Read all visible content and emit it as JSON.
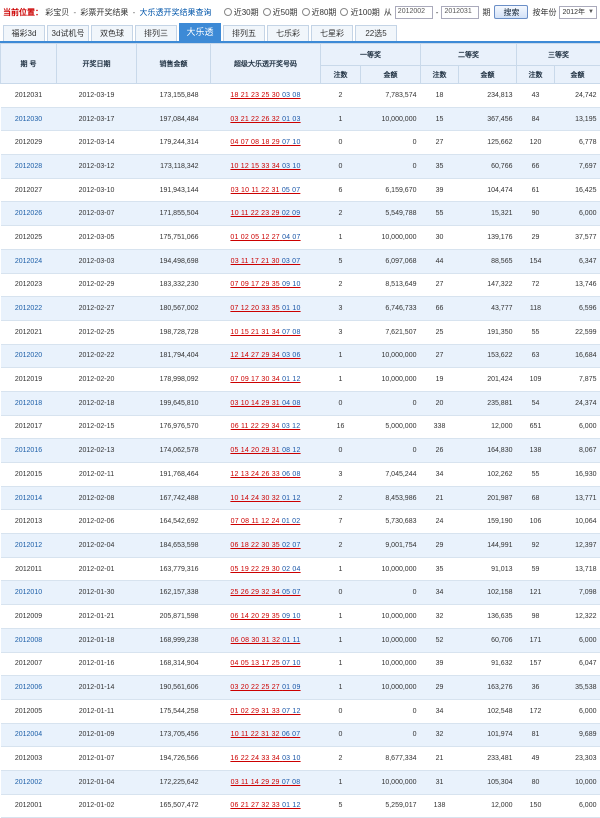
{
  "breadcrumb": {
    "label": "当前位置：",
    "items": [
      "彩宝贝",
      "彩票开奖结果",
      "大乐透开奖结果查询"
    ],
    "sep": "-"
  },
  "filters": {
    "radios": [
      "近30期",
      "近50期",
      "近80期",
      "近100期"
    ],
    "from_label": "从",
    "from_value": "2012002",
    "to_value": "2012031",
    "period_label": "期",
    "search_label": "搜索",
    "year_label": "按年份",
    "year_value": "2012年"
  },
  "tabs": [
    "福彩3d",
    "3d试机号",
    "双色球",
    "排列三",
    "大乐透",
    "排列五",
    "七乐彩",
    "七星彩",
    "22选5"
  ],
  "active_tab": 4,
  "table": {
    "headers": {
      "issue": "期 号",
      "date": "开奖日期",
      "sales": "销售金额",
      "numbers": "超级大乐透开奖号码",
      "first": "一等奖",
      "second": "二等奖",
      "third": "三等奖",
      "count": "注数",
      "amount": "金额"
    },
    "rows": [
      {
        "issue": "2012031",
        "date": "2012-03-19",
        "sales": "173,155,848",
        "front": "18 21 23 25 30",
        "back": "03 08",
        "c1": "2",
        "a1": "7,783,574",
        "c2": "18",
        "a2": "234,813",
        "c3": "43",
        "a3": "24,742"
      },
      {
        "issue": "2012030",
        "date": "2012-03-17",
        "sales": "197,084,484",
        "front": "03 21 22 26 32",
        "back": "01 03",
        "c1": "1",
        "a1": "10,000,000",
        "c2": "15",
        "a2": "367,456",
        "c3": "84",
        "a3": "13,195"
      },
      {
        "issue": "2012029",
        "date": "2012-03-14",
        "sales": "179,244,314",
        "front": "04 07 08 18 29",
        "back": "07 10",
        "c1": "0",
        "a1": "0",
        "c2": "27",
        "a2": "125,662",
        "c3": "120",
        "a3": "6,778"
      },
      {
        "issue": "2012028",
        "date": "2012-03-12",
        "sales": "173,118,342",
        "front": "10 12 15 33 34",
        "back": "03 10",
        "c1": "0",
        "a1": "0",
        "c2": "35",
        "a2": "60,766",
        "c3": "66",
        "a3": "7,697"
      },
      {
        "issue": "2012027",
        "date": "2012-03-10",
        "sales": "191,943,144",
        "front": "03 10 11 22 31",
        "back": "05 07",
        "c1": "6",
        "a1": "6,159,670",
        "c2": "39",
        "a2": "104,474",
        "c3": "61",
        "a3": "16,425"
      },
      {
        "issue": "2012026",
        "date": "2012-03-07",
        "sales": "171,855,504",
        "front": "10 11 22 23 29",
        "back": "02 09",
        "c1": "2",
        "a1": "5,549,788",
        "c2": "55",
        "a2": "15,321",
        "c3": "90",
        "a3": "6,000"
      },
      {
        "issue": "2012025",
        "date": "2012-03-05",
        "sales": "175,751,066",
        "front": "01 02 05 12 27",
        "back": "04 07",
        "c1": "1",
        "a1": "10,000,000",
        "c2": "30",
        "a2": "139,176",
        "c3": "29",
        "a3": "37,577"
      },
      {
        "issue": "2012024",
        "date": "2012-03-03",
        "sales": "194,498,698",
        "front": "03 11 17 21 30",
        "back": "03 07",
        "c1": "5",
        "a1": "6,097,068",
        "c2": "44",
        "a2": "88,565",
        "c3": "154",
        "a3": "6,347"
      },
      {
        "issue": "2012023",
        "date": "2012-02-29",
        "sales": "183,332,230",
        "front": "07 09 17 29 35",
        "back": "09 10",
        "c1": "2",
        "a1": "8,513,649",
        "c2": "27",
        "a2": "147,322",
        "c3": "72",
        "a3": "13,746"
      },
      {
        "issue": "2012022",
        "date": "2012-02-27",
        "sales": "180,567,002",
        "front": "07 12 20 33 35",
        "back": "01 10",
        "c1": "3",
        "a1": "6,746,733",
        "c2": "66",
        "a2": "43,777",
        "c3": "118",
        "a3": "6,596"
      },
      {
        "issue": "2012021",
        "date": "2012-02-25",
        "sales": "198,728,728",
        "front": "10 15 21 31 34",
        "back": "07 08",
        "c1": "3",
        "a1": "7,621,507",
        "c2": "25",
        "a2": "191,350",
        "c3": "55",
        "a3": "22,599"
      },
      {
        "issue": "2012020",
        "date": "2012-02-22",
        "sales": "181,794,404",
        "front": "12 14 27 29 34",
        "back": "03 06",
        "c1": "1",
        "a1": "10,000,000",
        "c2": "27",
        "a2": "153,622",
        "c3": "63",
        "a3": "16,684"
      },
      {
        "issue": "2012019",
        "date": "2012-02-20",
        "sales": "178,998,092",
        "front": "07 09 17 30 34",
        "back": "01 12",
        "c1": "1",
        "a1": "10,000,000",
        "c2": "19",
        "a2": "201,424",
        "c3": "109",
        "a3": "7,875"
      },
      {
        "issue": "2012018",
        "date": "2012-02-18",
        "sales": "199,645,810",
        "front": "03 10 14 29 31",
        "back": "04 08",
        "c1": "0",
        "a1": "0",
        "c2": "20",
        "a2": "235,881",
        "c3": "54",
        "a3": "24,374"
      },
      {
        "issue": "2012017",
        "date": "2012-02-15",
        "sales": "176,976,570",
        "front": "06 11 22 29 34",
        "back": "03 12",
        "c1": "16",
        "a1": "5,000,000",
        "c2": "338",
        "a2": "12,000",
        "c3": "651",
        "a3": "6,000"
      },
      {
        "issue": "2012016",
        "date": "2012-02-13",
        "sales": "174,062,578",
        "front": "05 14 20 29 31",
        "back": "08 12",
        "c1": "0",
        "a1": "0",
        "c2": "26",
        "a2": "164,830",
        "c3": "138",
        "a3": "8,067"
      },
      {
        "issue": "2012015",
        "date": "2012-02-11",
        "sales": "191,768,464",
        "front": "12 13 24 26 33",
        "back": "06 08",
        "c1": "3",
        "a1": "7,045,244",
        "c2": "34",
        "a2": "102,262",
        "c3": "55",
        "a3": "16,930"
      },
      {
        "issue": "2012014",
        "date": "2012-02-08",
        "sales": "167,742,488",
        "front": "10 14 24 30 32",
        "back": "01 12",
        "c1": "2",
        "a1": "8,453,986",
        "c2": "21",
        "a2": "201,987",
        "c3": "68",
        "a3": "13,771"
      },
      {
        "issue": "2012013",
        "date": "2012-02-06",
        "sales": "164,542,692",
        "front": "07 08 11 12 24",
        "back": "01 02",
        "c1": "7",
        "a1": "5,730,683",
        "c2": "24",
        "a2": "159,190",
        "c3": "106",
        "a3": "10,064"
      },
      {
        "issue": "2012012",
        "date": "2012-02-04",
        "sales": "184,653,598",
        "front": "06 18 22 30 35",
        "back": "02 07",
        "c1": "2",
        "a1": "9,001,754",
        "c2": "29",
        "a2": "144,991",
        "c3": "92",
        "a3": "12,397"
      },
      {
        "issue": "2012011",
        "date": "2012-02-01",
        "sales": "163,779,316",
        "front": "05 19 22 29 30",
        "back": "02 04",
        "c1": "1",
        "a1": "10,000,000",
        "c2": "35",
        "a2": "91,013",
        "c3": "59",
        "a3": "13,718"
      },
      {
        "issue": "2012010",
        "date": "2012-01-30",
        "sales": "162,157,338",
        "front": "25 26 29 32 34",
        "back": "05 07",
        "c1": "0",
        "a1": "0",
        "c2": "34",
        "a2": "102,158",
        "c3": "121",
        "a3": "7,098"
      },
      {
        "issue": "2012009",
        "date": "2012-01-21",
        "sales": "205,871,598",
        "front": "06 14 20 29 35",
        "back": "09 10",
        "c1": "1",
        "a1": "10,000,000",
        "c2": "32",
        "a2": "136,635",
        "c3": "98",
        "a3": "12,322"
      },
      {
        "issue": "2012008",
        "date": "2012-01-18",
        "sales": "168,999,238",
        "front": "06 08 30 31 32",
        "back": "01 11",
        "c1": "1",
        "a1": "10,000,000",
        "c2": "52",
        "a2": "60,706",
        "c3": "171",
        "a3": "6,000"
      },
      {
        "issue": "2012007",
        "date": "2012-01-16",
        "sales": "168,314,904",
        "front": "04 05 13 17 25",
        "back": "07 10",
        "c1": "1",
        "a1": "10,000,000",
        "c2": "39",
        "a2": "91,632",
        "c3": "157",
        "a3": "6,047"
      },
      {
        "issue": "2012006",
        "date": "2012-01-14",
        "sales": "190,561,606",
        "front": "03 20 22 25 27",
        "back": "01 09",
        "c1": "1",
        "a1": "10,000,000",
        "c2": "29",
        "a2": "163,276",
        "c3": "36",
        "a3": "35,538"
      },
      {
        "issue": "2012005",
        "date": "2012-01-11",
        "sales": "175,544,258",
        "front": "01 02 29 31 33",
        "back": "07 12",
        "c1": "0",
        "a1": "0",
        "c2": "34",
        "a2": "102,548",
        "c3": "172",
        "a3": "6,000"
      },
      {
        "issue": "2012004",
        "date": "2012-01-09",
        "sales": "173,705,456",
        "front": "10 11 22 31 32",
        "back": "06 07",
        "c1": "0",
        "a1": "0",
        "c2": "32",
        "a2": "101,974",
        "c3": "81",
        "a3": "9,689"
      },
      {
        "issue": "2012003",
        "date": "2012-01-07",
        "sales": "194,726,566",
        "front": "16 22 24 33 34",
        "back": "03 10",
        "c1": "2",
        "a1": "8,677,334",
        "c2": "21",
        "a2": "233,481",
        "c3": "49",
        "a3": "23,303"
      },
      {
        "issue": "2012002",
        "date": "2012-01-04",
        "sales": "172,225,642",
        "front": "03 11 14 29 29",
        "back": "07 08",
        "c1": "1",
        "a1": "10,000,000",
        "c2": "31",
        "a2": "105,304",
        "c3": "80",
        "a3": "10,000"
      },
      {
        "issue": "2012001",
        "date": "2012-01-02",
        "sales": "165,507,472",
        "front": "06 21 27 32 33",
        "back": "01 12",
        "c1": "5",
        "a1": "5,259,017",
        "c2": "138",
        "a2": "12,000",
        "c3": "150",
        "a3": "6,000"
      }
    ]
  }
}
